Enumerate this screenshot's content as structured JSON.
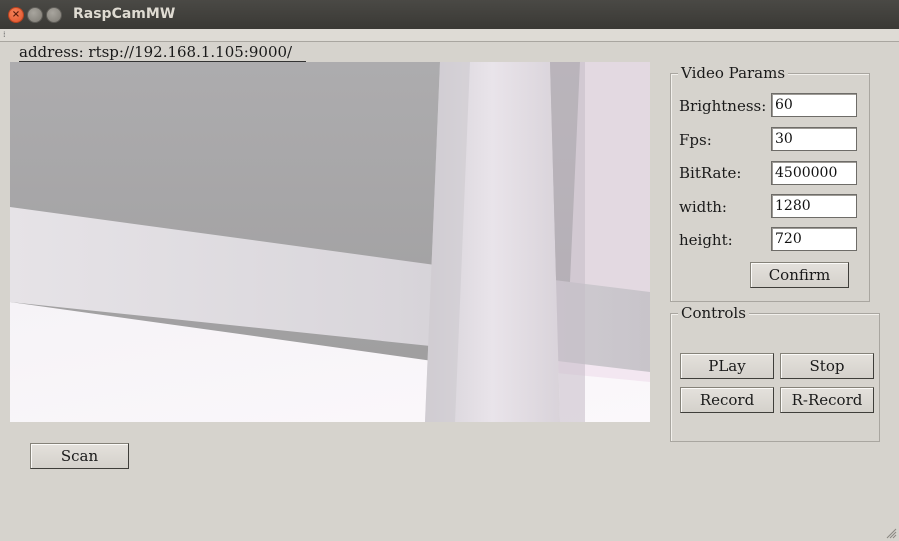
{
  "window": {
    "title": "RaspCamMW",
    "close_glyph": "×",
    "min_glyph": "–",
    "max_glyph": "□"
  },
  "address": {
    "label": "address: rtsp://192.168.1.105:9000/"
  },
  "video_params": {
    "title": "Video Params",
    "brightness_label": "Brightness:",
    "brightness_value": "60",
    "fps_label": "Fps:",
    "fps_value": "30",
    "bitrate_label": "BitRate:",
    "bitrate_value": "4500000",
    "width_label": "width:",
    "width_value": "1280",
    "height_label": "height:",
    "height_value": "720",
    "confirm_label": "Confirm"
  },
  "controls": {
    "title": "Controls",
    "play_label": "PLay",
    "stop_label": "Stop",
    "record_label": "Record",
    "rrecord_label": "R-Record"
  },
  "scan_label": "Scan",
  "icons": {
    "grip": "grip-icon",
    "resize": "resize-grip-icon"
  }
}
